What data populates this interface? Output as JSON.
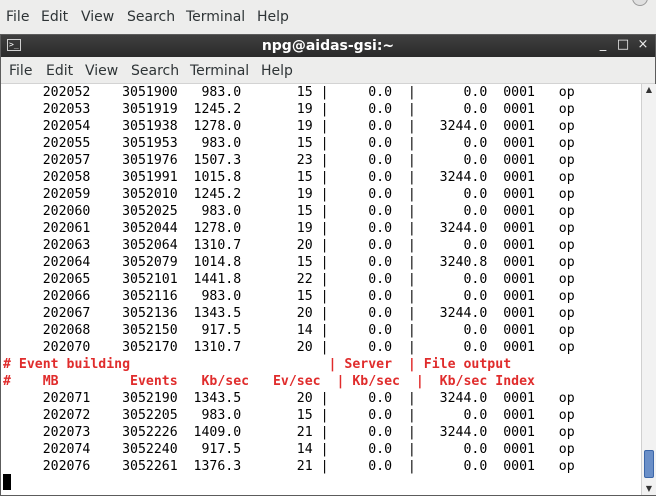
{
  "outer_menu": [
    "File",
    "Edit",
    "View",
    "Search",
    "Terminal",
    "Help"
  ],
  "window": {
    "title": "npg@aidas-gsi:~",
    "controls": [
      "_",
      "□",
      "×"
    ]
  },
  "menu": [
    "File",
    "Edit",
    "View",
    "Search",
    "Terminal",
    "Help"
  ],
  "terminal": {
    "lines_top": [
      "     202052    3051900   983.0       15 |     0.0  |      0.0  0001   op",
      "     202053    3051919  1245.2       19 |     0.0  |      0.0  0001   op",
      "     202054    3051938  1278.0       19 |     0.0  |   3244.0  0001   op",
      "     202055    3051953   983.0       15 |     0.0  |      0.0  0001   op",
      "     202057    3051976  1507.3       23 |     0.0  |      0.0  0001   op",
      "     202058    3051991  1015.8       15 |     0.0  |   3244.0  0001   op",
      "     202059    3052010  1245.2       19 |     0.0  |      0.0  0001   op",
      "     202060    3052025   983.0       15 |     0.0  |      0.0  0001   op",
      "     202061    3052044  1278.0       19 |     0.0  |   3244.0  0001   op",
      "     202063    3052064  1310.7       20 |     0.0  |      0.0  0001   op",
      "     202064    3052079  1014.8       15 |     0.0  |   3240.8  0001   op",
      "     202065    3052101  1441.8       22 |     0.0  |      0.0  0001   op",
      "     202066    3052116   983.0       15 |     0.0  |      0.0  0001   op",
      "     202067    3052136  1343.5       20 |     0.0  |   3244.0  0001   op",
      "     202068    3052150   917.5       14 |     0.0  |      0.0  0001   op",
      "     202070    3052170  1310.7       20 |     0.0  |      0.0  0001   op"
    ],
    "header_1": "# Event building                         | Server  | File output",
    "header_2": "#    MB         Events   Kb/sec   Ev/sec  | Kb/sec  |  Kb/sec Index",
    "lines_bottom": [
      "     202071    3052190  1343.5       20 |     0.0  |   3244.0  0001   op",
      "     202072    3052205   983.0       15 |     0.0  |      0.0  0001   op",
      "     202073    3052226  1409.0       21 |     0.0  |   3244.0  0001   op",
      "     202074    3052240   917.5       14 |     0.0  |      0.0  0001   op",
      "     202076    3052261  1376.3       21 |     0.0  |      0.0  0001   op"
    ]
  },
  "colors": {
    "header_text": "#e02c2c",
    "titlebar": "#2f2f2f",
    "scroll_thumb": "#6a8fc8"
  },
  "icons": {
    "window_icon": "terminal-icon",
    "scroll_up": "arrow-up-icon",
    "scroll_down": "arrow-down-icon"
  }
}
